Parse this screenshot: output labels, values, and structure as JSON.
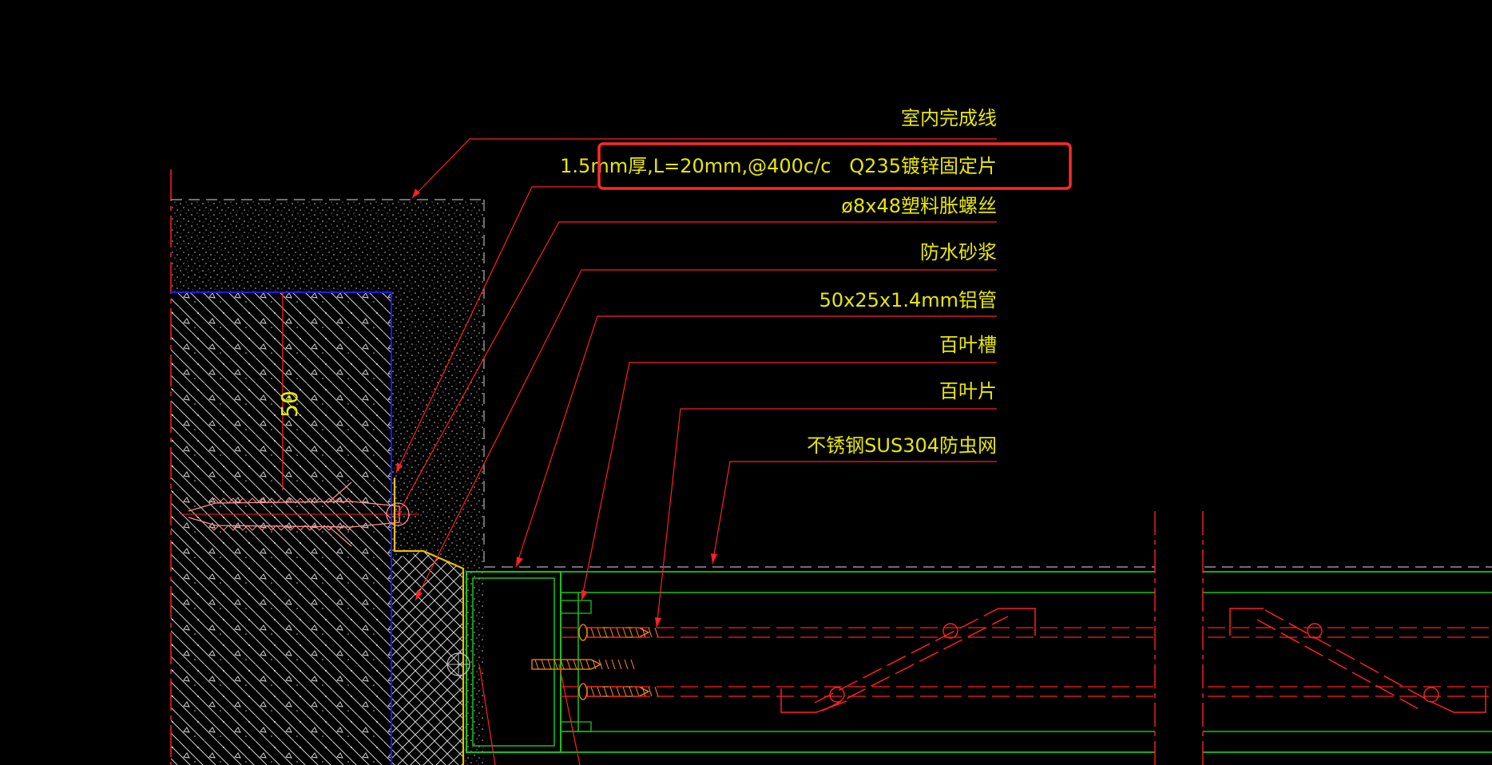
{
  "colors": {
    "background": "#000000",
    "leader": "#ff0000",
    "label": "#e8e800",
    "highlight": "#ff2a2a",
    "green": "#19c419",
    "blue": "#1a1aff",
    "screw": "#ff8c1a",
    "hatch": "#d9d9d9"
  },
  "labels": {
    "finish_line": "室内完成线",
    "fixing_plate": "1.5mm厚,L=20mm,@400c/c   Q235镀锌固定片",
    "expansion_screw": "ø8x48塑料胀螺丝",
    "waterproof_mortar": "防水砂浆",
    "aluminium_tube": "50x25x1.4mm铝管",
    "louver_slot": "百叶槽",
    "louver_blade": "百叶片",
    "insect_mesh": "不锈钢SUS304防虫网"
  },
  "dimension": {
    "value": "50"
  },
  "highlight_target": "fixing_plate"
}
